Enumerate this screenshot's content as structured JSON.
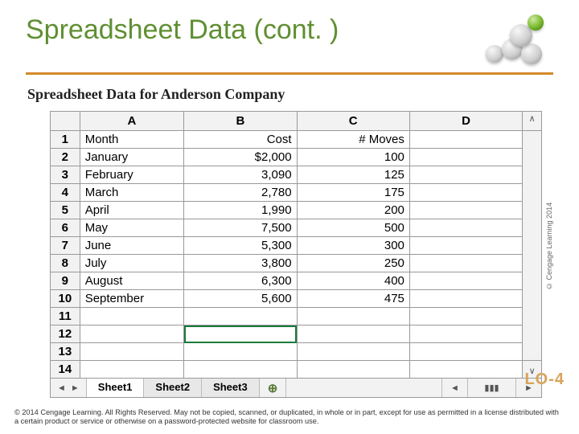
{
  "title": "Spreadsheet Data (cont. )",
  "subhead": "Spreadsheet Data for Anderson Company",
  "columns": {
    "A": "A",
    "B": "B",
    "C": "C",
    "D": "D"
  },
  "header_row": {
    "month": "Month",
    "cost": "Cost",
    "moves": "# Moves"
  },
  "rows": [
    {
      "n": "1"
    },
    {
      "n": "2",
      "month": "January",
      "cost": "$2,000",
      "moves": "100"
    },
    {
      "n": "3",
      "month": "February",
      "cost": "3,090",
      "moves": "125"
    },
    {
      "n": "4",
      "month": "March",
      "cost": "2,780",
      "moves": "175"
    },
    {
      "n": "5",
      "month": "April",
      "cost": "1,990",
      "moves": "200"
    },
    {
      "n": "6",
      "month": "May",
      "cost": "7,500",
      "moves": "500"
    },
    {
      "n": "7",
      "month": "June",
      "cost": "5,300",
      "moves": "300"
    },
    {
      "n": "8",
      "month": "July",
      "cost": "3,800",
      "moves": "250"
    },
    {
      "n": "9",
      "month": "August",
      "cost": "6,300",
      "moves": "400"
    },
    {
      "n": "10",
      "month": "September",
      "cost": "5,600",
      "moves": "475"
    },
    {
      "n": "11"
    },
    {
      "n": "12"
    },
    {
      "n": "13"
    },
    {
      "n": "14"
    }
  ],
  "tabs": {
    "sheet1": "Sheet1",
    "sheet2": "Sheet2",
    "sheet3": "Sheet3"
  },
  "image_credit": "© Cengage Learning 2014",
  "lo_tag": "LO-4",
  "footer": "© 2014 Cengage Learning. All Rights Reserved. May not be copied, scanned, or duplicated, in whole or in part, except for use as permitted in a license distributed with a certain product or service or otherwise on a password-protected website for classroom use."
}
